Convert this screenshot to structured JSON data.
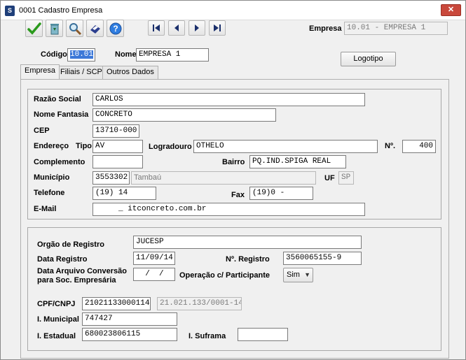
{
  "window": {
    "title": "0001 Cadastro Empresa",
    "close_symbol": "✕"
  },
  "toolbar": {
    "icons": [
      "confirm-check-icon",
      "recycle-bin-icon",
      "search-magnifier-icon",
      "print-icon",
      "help-icon"
    ],
    "nav": [
      "first-record-icon",
      "previous-record-icon",
      "next-record-icon",
      "last-record-icon"
    ]
  },
  "header": {
    "empresa_label": "Empresa",
    "empresa_value": "10.01 - EMPRESA 1",
    "codigo_label": "Código",
    "codigo_value": "10.01",
    "nome_label": "Nome",
    "nome_value": "EMPRESA 1",
    "logotipo_label": "Logotipo"
  },
  "tabs": [
    {
      "label": "Empresa",
      "active": true
    },
    {
      "label": "Filiais / SCP",
      "active": false
    },
    {
      "label": "Outros Dados",
      "active": false
    }
  ],
  "empresa": {
    "razao_social_label": "Razão Social",
    "razao_social": "CARLOS",
    "nome_fantasia_label": "Nome Fantasia",
    "nome_fantasia": "CONCRETO",
    "cep_label": "CEP",
    "cep": "13710-000",
    "endereco_label": "Endereço",
    "tipo_label": "Tipo",
    "tipo": "AV",
    "logradouro_label": "Logradouro",
    "logradouro": "OTHELO",
    "numero_label": "Nº.",
    "numero": "400",
    "complemento_label": "Complemento",
    "complemento": "",
    "bairro_label": "Bairro",
    "bairro": "PQ.IND.SPIGA REAL",
    "municipio_label": "Município",
    "municipio_codigo": "3553302",
    "municipio_nome": "Tambaú",
    "uf_label": "UF",
    "uf": "SP",
    "telefone_label": "Telefone",
    "telefone": "(19)        14",
    "fax_label": "Fax",
    "fax": "(19)0    -",
    "email_label": "E-Mail",
    "email": "     _ itconcreto.com.br"
  },
  "registro": {
    "orgao_label": "Orgão de Registro",
    "orgao": "JUCESP",
    "data_registro_label": "Data Registro",
    "data_registro": "11/09/14",
    "numero_registro_label": "Nº. Registro",
    "numero_registro": "3560065155-9",
    "data_arquivo_label_1": "Data Arquivo Conversão",
    "data_arquivo_label_2": "para Soc. Empresária",
    "data_arquivo": "  /  /",
    "operacao_label": "Operação c/ Participante",
    "operacao": "Sim",
    "cpf_cnpj_label": "CPF/CNPJ",
    "cpf_cnpj": "21021133000114",
    "cpf_cnpj_formatado": "21.021.133/0001-14",
    "i_municipal_label": "I. Municipal",
    "i_municipal": "747427",
    "i_estadual_label": "I. Estadual",
    "i_estadual": "680023806115",
    "i_suframa_label": "I. Suframa",
    "i_suframa": ""
  }
}
